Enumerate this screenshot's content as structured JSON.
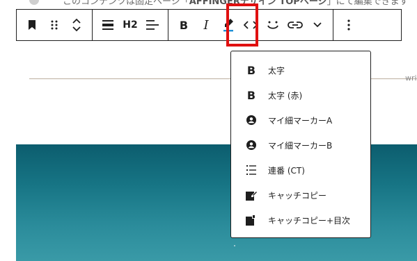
{
  "notice": {
    "text_prefix": "このコンテンツは固定ページ「",
    "text_bold": "AFFINGERデザイン TOPページ",
    "text_suffix": "」にて編集できます"
  },
  "toolbar": {
    "heading_level_label": "H2",
    "bold_label": "B",
    "italic_label": "I",
    "highlight_color": "#e01010"
  },
  "side_text": "wri",
  "menu": {
    "items": [
      {
        "icon": "bold-icon",
        "glyph": "B",
        "label": "太字"
      },
      {
        "icon": "bold-icon",
        "glyph": "B",
        "label": "太字 (赤)"
      },
      {
        "icon": "user-circle-icon",
        "glyph": "",
        "label": "マイ細マーカーA"
      },
      {
        "icon": "user-circle-icon",
        "glyph": "",
        "label": "マイ細マーカーB"
      },
      {
        "icon": "numbered-list-icon",
        "glyph": "",
        "label": "連番 (CT)"
      },
      {
        "icon": "edit-note-icon",
        "glyph": "",
        "label": "キャッチコピー"
      },
      {
        "icon": "edit-note-icon",
        "glyph": "",
        "label": "キャッチコピー+目次"
      }
    ]
  },
  "colors": {
    "hero_top": "#0c5d6e",
    "hero_bottom": "#3a9aa7",
    "accent_pen": "#1e90d6"
  }
}
